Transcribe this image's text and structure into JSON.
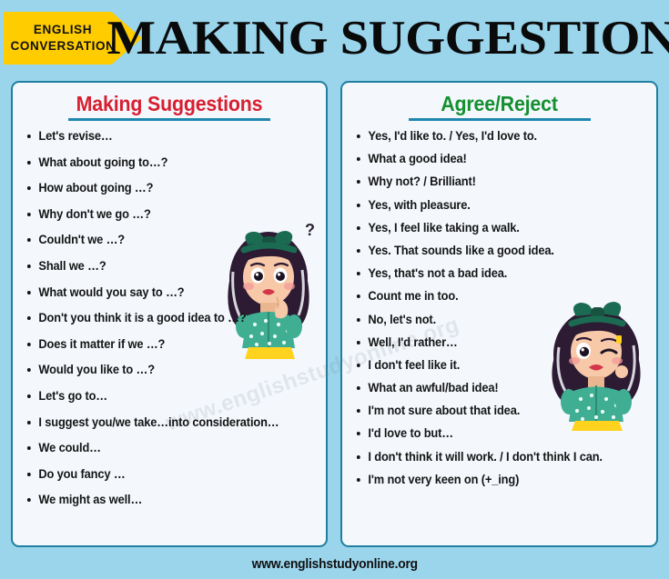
{
  "header": {
    "badge_line1": "ENGLISH",
    "badge_line2": "CONVERSATION",
    "badge_color": "#ffcc00",
    "title": "MAKING SUGGESTIONS",
    "background_color": "#9ad5ec"
  },
  "cards": {
    "left": {
      "title": "Making Suggestions",
      "title_color": "#d81f30",
      "rule_color": "#1f87ad",
      "items": [
        "Let's revise…",
        "What about going to…?",
        "How about going …?",
        "Why don't we go …?",
        "Couldn't we …?",
        "Shall we …?",
        "What would you say to …?",
        "Don't you think it is a good idea to …?",
        "Does it matter if we …?",
        "Would you like to …?",
        "Let's go to…",
        "I suggest you/we take…into consideration…",
        "We could…",
        "Do you fancy …",
        "We might as well…"
      ]
    },
    "right": {
      "title": "Agree/Reject",
      "title_color": "#149030",
      "rule_color": "#1f87ad",
      "items": [
        "Yes, I'd like to. / Yes, I'd love to.",
        "What a good idea!",
        "Why not? / Brilliant!",
        "Yes, with pleasure.",
        "Yes, I feel like taking a walk.",
        "Yes. That sounds like a good idea.",
        "Yes, that's not a bad idea.",
        "Count me in too.",
        "No, let's not.",
        "Well, I'd rather…",
        "I don't feel like it.",
        "What an awful/bad idea!",
        "I'm not sure about that idea.",
        "I'd love to but…",
        "I don't think it will work. / I don't think I can.",
        "I'm not very keen on (+_ing)"
      ]
    }
  },
  "watermark": "www.englishstudyonline.org",
  "footer": {
    "url": "www.englishstudyonline.org"
  },
  "illustrations": {
    "left": "thinking-girl-illustration",
    "right": "winking-girl-illustration"
  }
}
